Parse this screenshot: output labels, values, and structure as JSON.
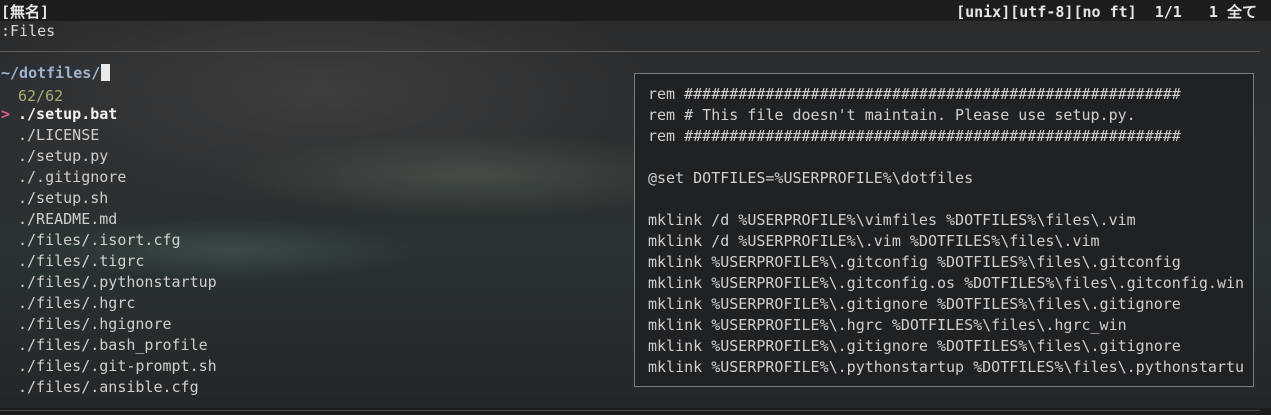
{
  "statusline": {
    "buffer_name": "[無名]",
    "right_info": "[unix][utf-8][no ft]  1/1   1 全て"
  },
  "cmdline": {
    "text": ":Files"
  },
  "finder": {
    "prompt": "~/dotfiles/",
    "counter": "62/62",
    "selected_marker": ">",
    "items": [
      "./setup.bat",
      "./LICENSE",
      "./setup.py",
      "./.gitignore",
      "./setup.sh",
      "./README.md",
      "./files/.isort.cfg",
      "./files/.tigrc",
      "./files/.pythonstartup",
      "./files/.hgrc",
      "./files/.hgignore",
      "./files/.bash_profile",
      "./files/.git-prompt.sh",
      "./files/.ansible.cfg"
    ]
  },
  "preview": {
    "lines": [
      "rem #######################################################",
      "rem # This file doesn't maintain. Please use setup.py.",
      "rem #######################################################",
      "",
      "@set DOTFILES=%USERPROFILE%\\dotfiles",
      "",
      "mklink /d %USERPROFILE%\\vimfiles %DOTFILES%\\files\\.vim",
      "mklink /d %USERPROFILE%\\.vim %DOTFILES%\\files\\.vim",
      "mklink %USERPROFILE%\\.gitconfig %DOTFILES%\\files\\.gitconfig",
      "mklink %USERPROFILE%\\.gitconfig.os %DOTFILES%\\files\\.gitconfig.win",
      "mklink %USERPROFILE%\\.gitignore %DOTFILES%\\files\\.gitignore",
      "mklink %USERPROFILE%\\.hgrc %DOTFILES%\\files\\.hgrc_win",
      "mklink %USERPROFILE%\\.gitignore %DOTFILES%\\files\\.gitignore",
      "mklink %USERPROFILE%\\.pythonstartup %DOTFILES%\\files\\.pythonstartu"
    ]
  }
}
